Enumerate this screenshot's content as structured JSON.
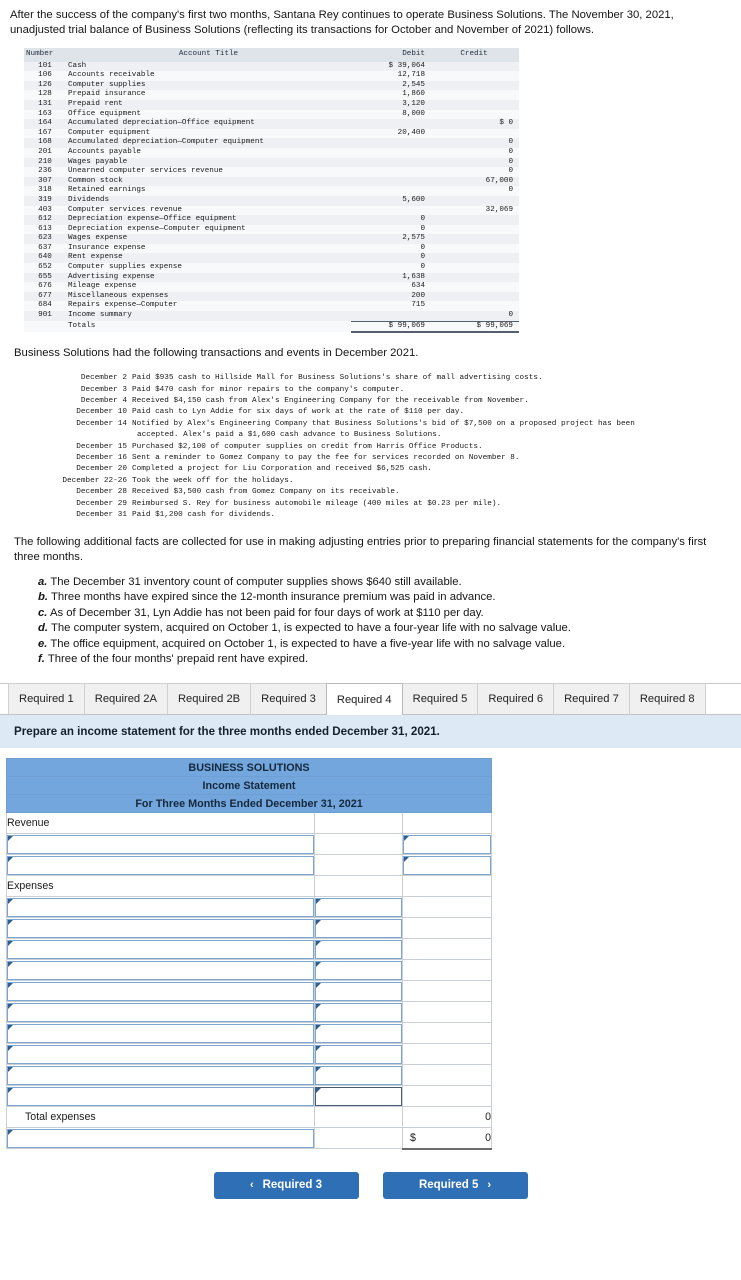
{
  "intro": {
    "paragraph": "After the success of the company's first two months, Santana Rey continues to operate Business Solutions. The November 30, 2021, unadjusted trial balance of Business Solutions (reflecting its transactions for October and November of 2021) follows."
  },
  "trial_balance": {
    "headers": {
      "number": "Number",
      "title": "Account Title",
      "debit": "Debit",
      "credit": "Credit"
    },
    "rows": [
      {
        "number": "101",
        "title": "Cash",
        "debit": "$ 39,064",
        "credit": ""
      },
      {
        "number": "106",
        "title": "Accounts receivable",
        "debit": "12,718",
        "credit": ""
      },
      {
        "number": "126",
        "title": "Computer supplies",
        "debit": "2,545",
        "credit": ""
      },
      {
        "number": "128",
        "title": "Prepaid insurance",
        "debit": "1,860",
        "credit": ""
      },
      {
        "number": "131",
        "title": "Prepaid rent",
        "debit": "3,120",
        "credit": ""
      },
      {
        "number": "163",
        "title": "Office equipment",
        "debit": "8,000",
        "credit": ""
      },
      {
        "number": "164",
        "title": "Accumulated depreciation—Office equipment",
        "debit": "",
        "credit": "$ 0"
      },
      {
        "number": "167",
        "title": "Computer equipment",
        "debit": "20,400",
        "credit": ""
      },
      {
        "number": "168",
        "title": "Accumulated depreciation—Computer equipment",
        "debit": "",
        "credit": "0"
      },
      {
        "number": "201",
        "title": "Accounts payable",
        "debit": "",
        "credit": "0"
      },
      {
        "number": "210",
        "title": "Wages payable",
        "debit": "",
        "credit": "0"
      },
      {
        "number": "236",
        "title": "Unearned computer services revenue",
        "debit": "",
        "credit": "0"
      },
      {
        "number": "307",
        "title": "Common stock",
        "debit": "",
        "credit": "67,000"
      },
      {
        "number": "318",
        "title": "Retained earnings",
        "debit": "",
        "credit": "0"
      },
      {
        "number": "319",
        "title": "Dividends",
        "debit": "5,600",
        "credit": ""
      },
      {
        "number": "403",
        "title": "Computer services revenue",
        "debit": "",
        "credit": "32,069"
      },
      {
        "number": "612",
        "title": "Depreciation expense—Office equipment",
        "debit": "0",
        "credit": ""
      },
      {
        "number": "613",
        "title": "Depreciation expense—Computer equipment",
        "debit": "0",
        "credit": ""
      },
      {
        "number": "623",
        "title": "Wages expense",
        "debit": "2,575",
        "credit": ""
      },
      {
        "number": "637",
        "title": "Insurance expense",
        "debit": "0",
        "credit": ""
      },
      {
        "number": "640",
        "title": "Rent expense",
        "debit": "0",
        "credit": ""
      },
      {
        "number": "652",
        "title": "Computer supplies expense",
        "debit": "0",
        "credit": ""
      },
      {
        "number": "655",
        "title": "Advertising expense",
        "debit": "1,638",
        "credit": ""
      },
      {
        "number": "676",
        "title": "Mileage expense",
        "debit": "634",
        "credit": ""
      },
      {
        "number": "677",
        "title": "Miscellaneous expenses",
        "debit": "200",
        "credit": ""
      },
      {
        "number": "684",
        "title": "Repairs expense—Computer",
        "debit": "715",
        "credit": ""
      },
      {
        "number": "901",
        "title": "Income summary",
        "debit": "",
        "credit": "0"
      }
    ],
    "totals": {
      "label": "Totals",
      "debit": "$ 99,069",
      "credit": "$ 99,069"
    }
  },
  "transactions": {
    "lead": "Business Solutions had the following transactions and events in December 2021.",
    "items": [
      {
        "date": "December 2",
        "text": "Paid $935 cash to Hillside Mall for Business Solutions's share of mall advertising costs.",
        "cont": ""
      },
      {
        "date": "December 3",
        "text": "Paid $470 cash for minor repairs to the company's computer.",
        "cont": ""
      },
      {
        "date": "December 4",
        "text": "Received $4,150 cash from Alex's Engineering Company for the receivable from November.",
        "cont": ""
      },
      {
        "date": "December 10",
        "text": "Paid cash to Lyn Addie for six days of work at the rate of $110 per day.",
        "cont": ""
      },
      {
        "date": "December 14",
        "text": "Notified by Alex's Engineering Company that Business Solutions's bid of $7,500 on a proposed project has been",
        "cont": "accepted. Alex's paid a $1,600 cash advance to Business Solutions."
      },
      {
        "date": "December 15",
        "text": "Purchased $2,100 of computer supplies on credit from Harris Office Products.",
        "cont": ""
      },
      {
        "date": "December 16",
        "text": "Sent a reminder to Gomez Company to pay the fee for services recorded on November 8.",
        "cont": ""
      },
      {
        "date": "December 20",
        "text": "Completed a project for Liu Corporation and received $6,525 cash.",
        "cont": ""
      },
      {
        "date": "December 22-26",
        "text": "Took the week off for the holidays.",
        "cont": ""
      },
      {
        "date": "December 28",
        "text": "Received $3,500 cash from Gomez Company on its receivable.",
        "cont": ""
      },
      {
        "date": "December 29",
        "text": "Reimbursed S. Rey for business automobile mileage (400 miles at $0.23 per mile).",
        "cont": ""
      },
      {
        "date": "December 31",
        "text": "Paid $1,200 cash for dividends.",
        "cont": ""
      }
    ]
  },
  "facts": {
    "lead": "The following additional facts are collected for use in making adjusting entries prior to preparing financial statements for the company's first three months.",
    "items": [
      {
        "marker": "a.",
        "text": "The December 31 inventory count of computer supplies shows $640 still available."
      },
      {
        "marker": "b.",
        "text": "Three months have expired since the 12-month insurance premium was paid in advance."
      },
      {
        "marker": "c.",
        "text": "As of December 31, Lyn Addie has not been paid for four days of work at $110 per day."
      },
      {
        "marker": "d.",
        "text": "The computer system, acquired on October 1, is expected to have a four-year life with no salvage value."
      },
      {
        "marker": "e.",
        "text": "The office equipment, acquired on October 1, is expected to have a five-year life with no salvage value."
      },
      {
        "marker": "f.",
        "text": "Three of the four months' prepaid rent have expired."
      }
    ]
  },
  "tabs": {
    "active_index": 4,
    "items": [
      {
        "label": "Required 1"
      },
      {
        "label": "Required 2A"
      },
      {
        "label": "Required 2B"
      },
      {
        "label": "Required 3"
      },
      {
        "label": "Required 4"
      },
      {
        "label": "Required 5"
      },
      {
        "label": "Required 6"
      },
      {
        "label": "Required 7"
      },
      {
        "label": "Required 8"
      }
    ]
  },
  "prompt": "Prepare an income statement for the three months ended December 31, 2021.",
  "income_statement": {
    "title_lines": [
      "BUSINESS SOLUTIONS",
      "Income Statement",
      "For Three Months Ended December 31, 2021"
    ],
    "section_revenue_label": "Revenue",
    "section_expenses_label": "Expenses",
    "revenue_rows": [
      {
        "label": "",
        "col2": "",
        "col3": ""
      },
      {
        "label": "",
        "col2": "",
        "col3": ""
      }
    ],
    "expense_rows": [
      {
        "label": "",
        "col2": ""
      },
      {
        "label": "",
        "col2": ""
      },
      {
        "label": "",
        "col2": ""
      },
      {
        "label": "",
        "col2": ""
      },
      {
        "label": "",
        "col2": ""
      },
      {
        "label": "",
        "col2": ""
      },
      {
        "label": "",
        "col2": ""
      },
      {
        "label": "",
        "col2": ""
      },
      {
        "label": "",
        "col2": ""
      },
      {
        "label": "",
        "col2": ""
      }
    ],
    "total_expenses": {
      "label": "Total expenses",
      "value": "0"
    },
    "net_row": {
      "label": "",
      "dollar": "$",
      "value": "0"
    }
  },
  "footer_nav": {
    "prev": {
      "label": "Required 3",
      "icon": "chevron-left-icon",
      "glyph": "‹"
    },
    "next": {
      "label": "Required 5",
      "icon": "chevron-right-icon",
      "glyph": "›"
    }
  },
  "colors": {
    "header_blue": "#73a6dc",
    "prompt_blue": "#ddeaf6",
    "button_blue": "#2f6fb5",
    "cell_border": "#7da7d0"
  }
}
